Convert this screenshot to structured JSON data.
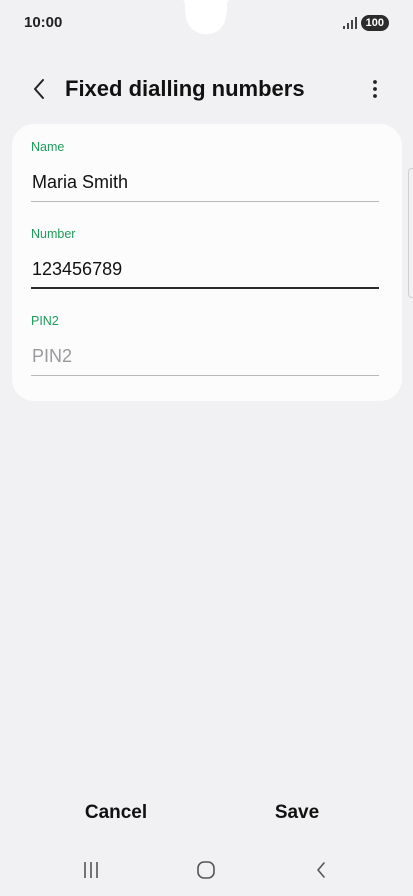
{
  "status_bar": {
    "time": "10:00",
    "battery": "100",
    "signal_icon": "signal-bars-icon"
  },
  "header": {
    "title": "Fixed dialling numbers",
    "back_icon": "chevron-left-icon",
    "more_icon": "more-vertical-icon"
  },
  "form": {
    "name": {
      "label": "Name",
      "value": "Maria Smith",
      "placeholder": ""
    },
    "number": {
      "label": "Number",
      "value": "123456789",
      "placeholder": ""
    },
    "pin2": {
      "label": "PIN2",
      "value": "",
      "placeholder": "PIN2"
    }
  },
  "actions": {
    "cancel_label": "Cancel",
    "save_label": "Save"
  },
  "nav": {
    "recent_icon": "recent-apps-icon",
    "home_icon": "home-icon",
    "back_icon": "back-icon"
  },
  "colors": {
    "background": "#f1f1f3",
    "card": "#fcfcfd",
    "label_accent": "#1c9c5b",
    "text": "#111111"
  }
}
